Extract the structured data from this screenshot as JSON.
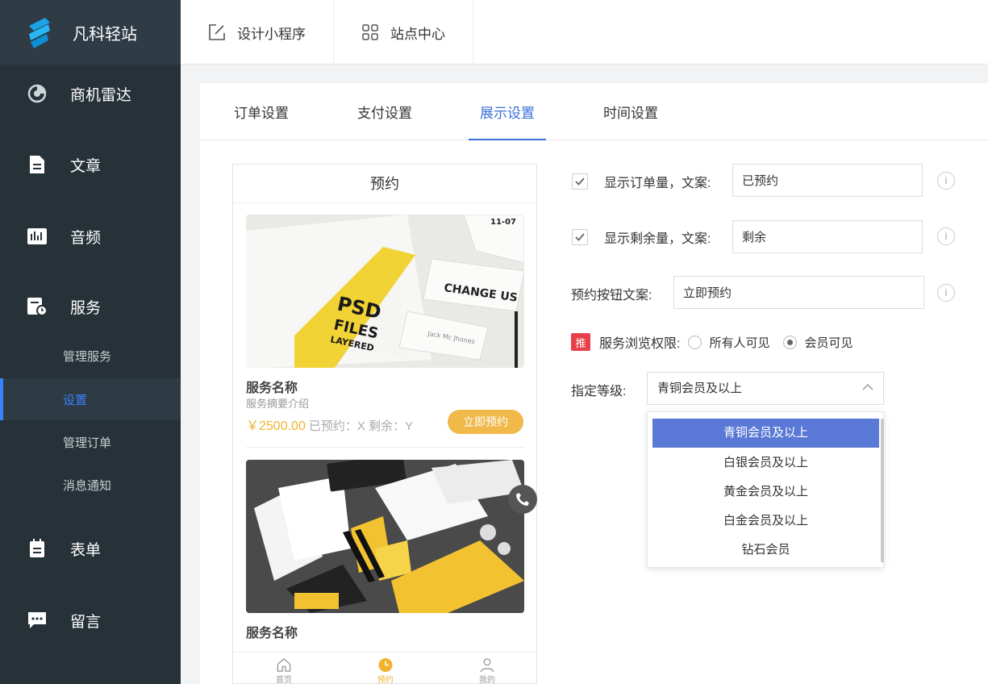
{
  "brand": {
    "name": "凡科轻站"
  },
  "sidebar": {
    "items": [
      {
        "label": "商机雷达",
        "icon": "radar-icon"
      },
      {
        "label": "文章",
        "icon": "article-icon"
      },
      {
        "label": "音频",
        "icon": "audio-icon"
      },
      {
        "label": "服务",
        "icon": "service-icon"
      },
      {
        "label": "表单",
        "icon": "form-icon"
      },
      {
        "label": "留言",
        "icon": "message-icon"
      }
    ],
    "sub_items": [
      {
        "label": "管理服务"
      },
      {
        "label": "设置",
        "active": true
      },
      {
        "label": "管理订单"
      },
      {
        "label": "消息通知"
      }
    ]
  },
  "topbar": {
    "tabs": [
      {
        "label": "设计小程序",
        "icon": "edit-icon"
      },
      {
        "label": "站点中心",
        "icon": "grid-icon"
      }
    ]
  },
  "tabs": [
    {
      "label": "订单设置"
    },
    {
      "label": "支付设置"
    },
    {
      "label": "展示设置",
      "active": true
    },
    {
      "label": "时间设置"
    }
  ],
  "preview": {
    "title": "预约",
    "card1": {
      "name": "服务名称",
      "desc": "服务摘要介绍",
      "price": "￥2500.00",
      "stock": "已预约：X 剩余：Y",
      "button": "立即预约",
      "image_text": {
        "psd": "PSD",
        "files": "FILES",
        "layered": "LAYERED",
        "change": "CHANGE US",
        "card_name": "Jack Mc Jhones",
        "date": "11-07"
      }
    },
    "card2": {
      "name": "服务名称"
    },
    "tabbar": [
      {
        "label": "首页",
        "icon": "home-icon"
      },
      {
        "label": "预约",
        "icon": "clock-icon",
        "active": true
      },
      {
        "label": "我的",
        "icon": "user-icon"
      }
    ]
  },
  "form": {
    "show_order_count": {
      "label": "显示订单量，文案:",
      "value": "已预约",
      "checked": true
    },
    "show_remaining": {
      "label": "显示剩余量，文案:",
      "value": "剩余",
      "checked": true
    },
    "book_button_text": {
      "label": "预约按钮文案:",
      "value": "立即预约"
    },
    "visibility": {
      "badge": "推",
      "label": "服务浏览权限:",
      "options": [
        {
          "label": "所有人可见",
          "checked": false
        },
        {
          "label": "会员可见",
          "checked": true
        }
      ]
    },
    "level": {
      "label": "指定等级:",
      "selected": "青铜会员及以上",
      "options": [
        "青铜会员及以上",
        "白银会员及以上",
        "黄金会员及以上",
        "白金会员及以上",
        "钻石会员"
      ]
    },
    "info_glyph": "i"
  },
  "colors": {
    "accent": "#3a6fd8",
    "sidebar_bg": "#263238",
    "price": "#f0b330",
    "selected_option": "#5a79d6"
  }
}
